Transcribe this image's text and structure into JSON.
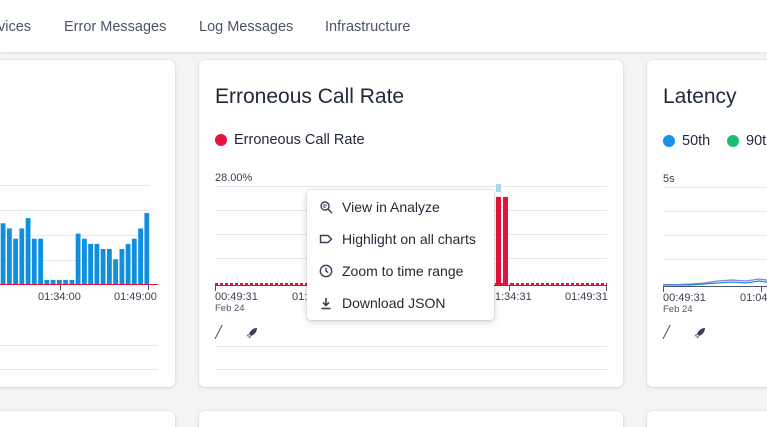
{
  "nav": {
    "items": [
      "vices",
      "Error Messages",
      "Log Messages",
      "Infrastructure"
    ]
  },
  "left_card": {
    "x_ticks": [
      "01:34:00",
      "01:49:00"
    ]
  },
  "erroneous_card": {
    "title": "Erroneous Call Rate",
    "legend": "Erroneous Call Rate",
    "y_top_label": "28.00%",
    "x_start": "00:49:31",
    "x_start_sub": "Feb 24",
    "x_mid_fragment": "01:",
    "x_end_fragment": "1:34:31",
    "x_last": "01:49:31"
  },
  "latency_card": {
    "title": "Latency",
    "legend_50": "50th",
    "legend_90": "90t",
    "y_top_label": "5s",
    "x_start": "00:49:31",
    "x_start_sub": "Feb 24",
    "x_next_fragment": "01:04"
  },
  "context_menu": {
    "items": [
      {
        "label": "View in Analyze",
        "icon": "search-analyze-icon"
      },
      {
        "label": "Highlight on all charts",
        "icon": "tag-icon"
      },
      {
        "label": "Zoom to time range",
        "icon": "clock-icon"
      },
      {
        "label": "Download JSON",
        "icon": "download-icon"
      }
    ]
  },
  "colors": {
    "bar_blue": "#0f8fde",
    "error_red": "#e5133a",
    "p50_blue": "#1a8fe3",
    "p90_green": "#16c172"
  },
  "chart_data": [
    {
      "type": "bar",
      "x_tick_labels": [
        "01:34:00",
        "01:49:00"
      ],
      "series": [
        {
          "values": [
            12,
            11,
            9,
            11,
            13,
            9,
            9,
            1,
            1,
            1,
            1,
            1,
            10,
            9,
            8,
            8,
            7,
            7,
            5,
            7,
            8,
            9,
            11,
            14
          ]
        }
      ]
    },
    {
      "type": "bar",
      "title": "Erroneous Call Rate",
      "y_tick_label": "28.00%",
      "x_tick_labels": [
        "00:49:31",
        "01:34:31",
        "01:49:31"
      ],
      "series": [
        {
          "name": "Erroneous Call Rate",
          "values": [
            0,
            0,
            0,
            0,
            0,
            0,
            0,
            0,
            0,
            0,
            0,
            0,
            0,
            0,
            0,
            0,
            0,
            0,
            0,
            0,
            0,
            0,
            0,
            0,
            0,
            0,
            0,
            0,
            0,
            0,
            0,
            0,
            0,
            0,
            0,
            0,
            0,
            0,
            0,
            0,
            25,
            26,
            26
          ]
        }
      ]
    },
    {
      "type": "line",
      "title": "Latency",
      "y_tick_label": "5s",
      "x_tick_labels": [
        "00:49:31",
        "01:04"
      ],
      "series": [
        {
          "name": "50th",
          "values": [
            0.1,
            0.1,
            0.1,
            0.15,
            0.2,
            0.25,
            0.2,
            0.3,
            0.2,
            0.25
          ]
        },
        {
          "name": "90t",
          "values": [
            0.12,
            0.12,
            0.15,
            0.2,
            0.3,
            0.35,
            0.3,
            0.4,
            0.3,
            0.35
          ]
        }
      ]
    }
  ]
}
